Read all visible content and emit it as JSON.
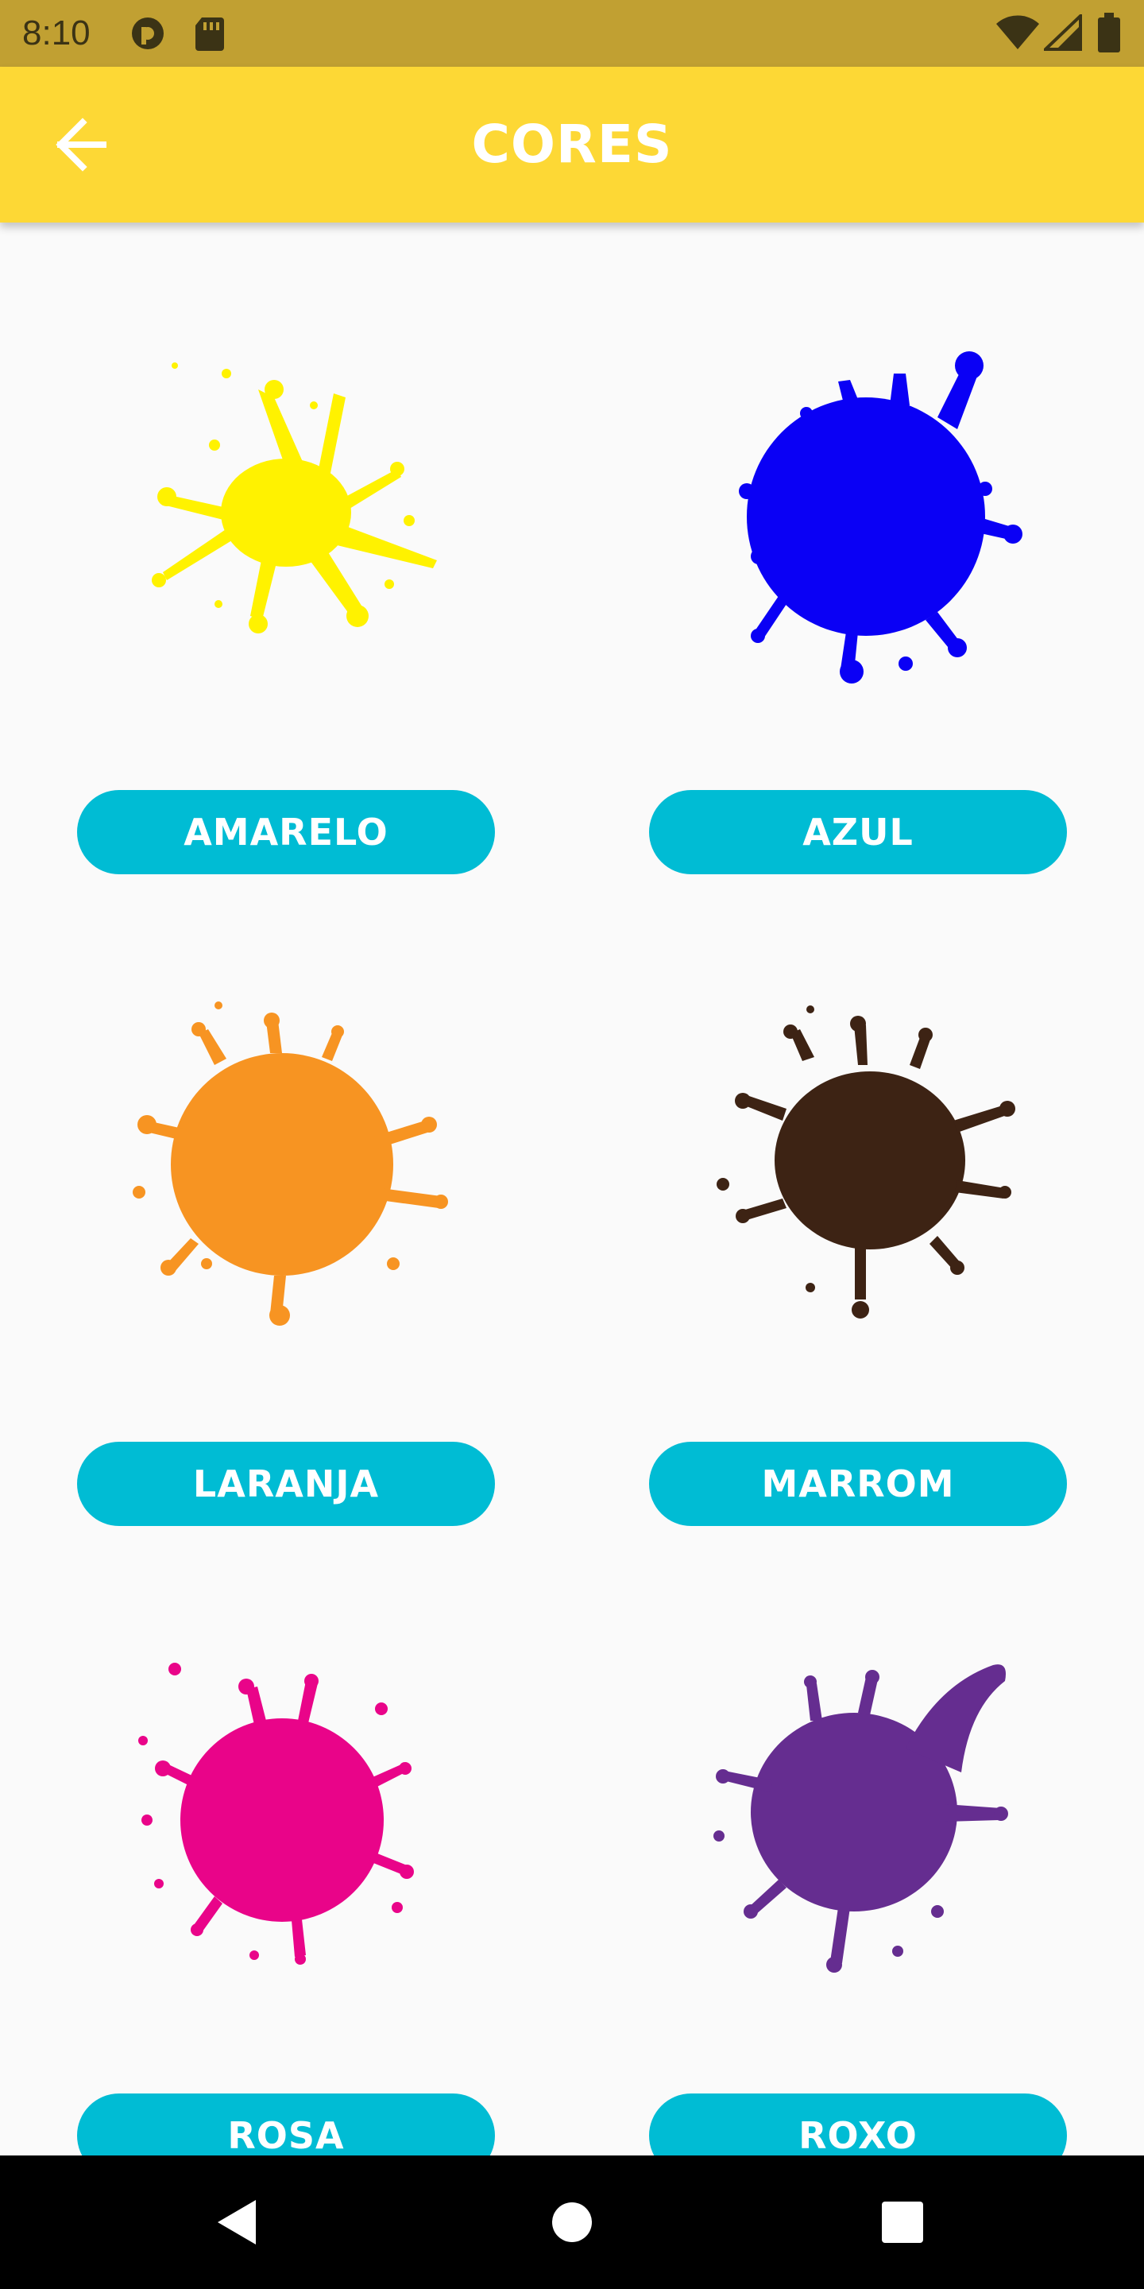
{
  "status_bar": {
    "time": "8:10",
    "icons": [
      "app-notification-icon",
      "sd-card-icon",
      "wifi-icon",
      "signal-icon",
      "battery-icon"
    ]
  },
  "app_bar": {
    "title": "CORES",
    "back_icon": "arrow-left-icon"
  },
  "colors": [
    {
      "label": "AMARELO",
      "hex": "#fff200"
    },
    {
      "label": "AZUL",
      "hex": "#0a00f5"
    },
    {
      "label": "LARANJA",
      "hex": "#f79422"
    },
    {
      "label": "MARROM",
      "hex": "#3d2314"
    },
    {
      "label": "ROSA",
      "hex": "#e90489"
    },
    {
      "label": "ROXO",
      "hex": "#652d90"
    }
  ],
  "theme": {
    "app_bar_color": "#fdd835",
    "status_bar_color": "#c1a032",
    "button_color": "#00bcd4",
    "background": "#fafafa"
  },
  "nav_bar": {
    "icons": [
      "back-triangle-icon",
      "home-circle-icon",
      "recents-square-icon"
    ]
  }
}
